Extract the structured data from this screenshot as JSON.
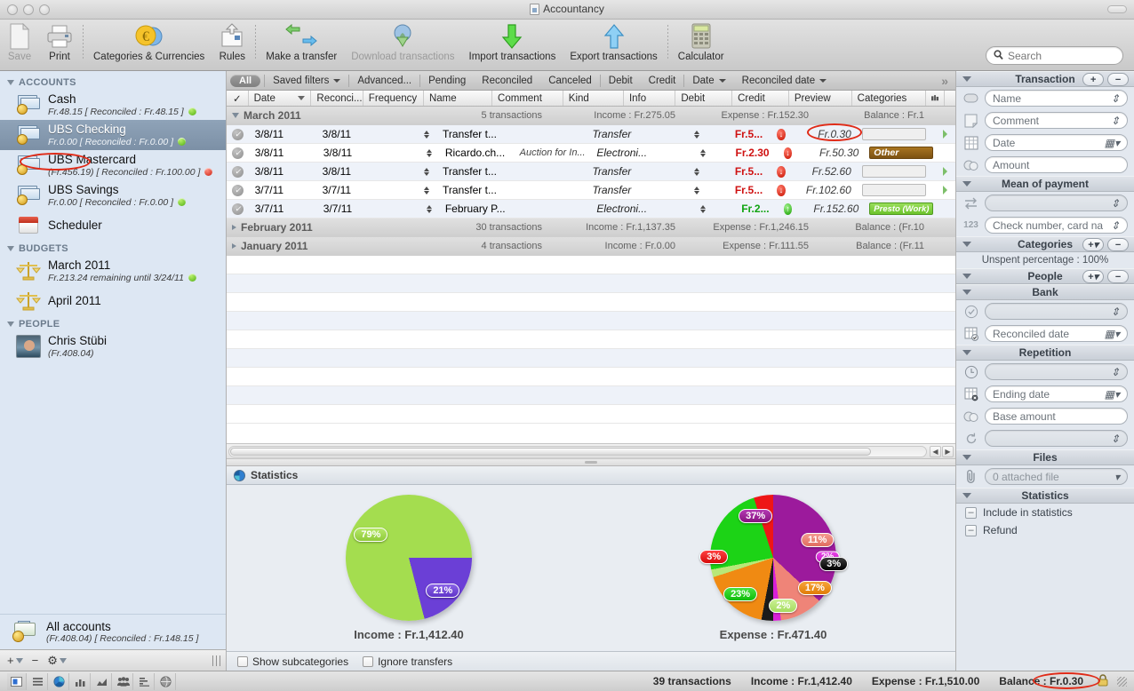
{
  "window": {
    "title": "Accountancy"
  },
  "toolbar": {
    "items": [
      {
        "label": "Save",
        "icon": "save-document-icon",
        "dim": true
      },
      {
        "label": "Print",
        "icon": "printer-icon",
        "dim": false
      },
      {
        "label": "Categories & Currencies",
        "icon": "euro-coin-icon",
        "dim": false
      },
      {
        "label": "Rules",
        "icon": "rules-envelope-icon",
        "dim": false
      },
      {
        "label": "Make a transfer",
        "icon": "transfer-arrows-icon",
        "dim": false
      },
      {
        "label": "Download transactions",
        "icon": "globe-download-icon",
        "dim": true
      },
      {
        "label": "Import transactions",
        "icon": "green-down-arrow-icon",
        "dim": false
      },
      {
        "label": "Export transactions",
        "icon": "blue-up-arrow-icon",
        "dim": false
      },
      {
        "label": "Calculator",
        "icon": "calculator-icon",
        "dim": false
      }
    ],
    "search_placeholder": "Search"
  },
  "sidebar": {
    "groups": [
      {
        "title": "ACCOUNTS",
        "items": [
          {
            "name": "Cash",
            "sub": "Fr.48.15 [ Reconciled : Fr.48.15 ]",
            "status": "green",
            "icon": "money-icon",
            "selected": false
          },
          {
            "name": "UBS Checking",
            "sub": "Fr.0.00 [ Reconciled : Fr.0.00 ]",
            "status": "green",
            "icon": "money-icon",
            "selected": true
          },
          {
            "name": "UBS Mastercard",
            "sub": "(Fr.456.19) [ Reconciled : Fr.100.00 ]",
            "status": "red",
            "icon": "money-icon",
            "selected": false
          },
          {
            "name": "UBS Savings",
            "sub": "Fr.0.00 [ Reconciled : Fr.0.00 ]",
            "status": "green",
            "icon": "money-icon",
            "selected": false
          },
          {
            "name": "Scheduler",
            "sub": "",
            "status": "",
            "icon": "calendar-icon",
            "selected": false
          }
        ]
      },
      {
        "title": "BUDGETS",
        "items": [
          {
            "name": "March 2011",
            "sub": "Fr.213.24 remaining until 3/24/11",
            "status": "green",
            "icon": "scale-icon",
            "selected": false
          },
          {
            "name": "April 2011",
            "sub": "",
            "status": "",
            "icon": "scale-icon",
            "selected": false
          }
        ]
      },
      {
        "title": "PEOPLE",
        "items": [
          {
            "name": "Chris Stübi",
            "sub": "(Fr.408.04)",
            "status": "",
            "icon": "avatar-icon",
            "selected": false
          }
        ]
      }
    ],
    "all_accounts": {
      "name": "All accounts",
      "sub": "(Fr.408.04) [ Reconciled : Fr.148.15 ]"
    },
    "footer": {
      "add": "+",
      "remove": "−",
      "gear": "⚙"
    }
  },
  "filterbar": {
    "all": "All",
    "items": [
      "Saved filters",
      "Advanced...",
      "Pending",
      "Reconciled",
      "Canceled",
      "Debit",
      "Credit",
      "Date",
      "Reconciled date"
    ],
    "overflow": "»"
  },
  "table": {
    "columns": [
      "✓",
      "Date",
      "Reconci...",
      "Frequency",
      "Name",
      "Comment",
      "Kind",
      "Info",
      "Debit",
      "Credit",
      "Preview",
      "Categories"
    ],
    "groups": [
      {
        "label": "March 2011",
        "expanded": true,
        "transactions": "5 transactions",
        "income": "Income : Fr.275.05",
        "expense": "Expense : Fr.152.30",
        "balance": "Balance : Fr.1",
        "rows": [
          {
            "date": "3/8/11",
            "reconciled": "3/8/11",
            "frequency": "",
            "name": "Transfer t...",
            "comment": "",
            "kind": "Transfer",
            "info": "",
            "debit": "Fr.5...",
            "debit_dir": "down",
            "credit": "",
            "preview": "Fr.0.30",
            "category": "",
            "category_style": "empty",
            "marker": true
          },
          {
            "date": "3/8/11",
            "reconciled": "3/8/11",
            "frequency": "",
            "name": "Ricardo.ch...",
            "comment": "Auction for In...",
            "kind": "Electroni...",
            "info": "",
            "debit": "Fr.2.30",
            "debit_dir": "down",
            "credit": "",
            "preview": "Fr.50.30",
            "category": "Other",
            "category_style": "other",
            "marker": false
          },
          {
            "date": "3/8/11",
            "reconciled": "3/8/11",
            "frequency": "",
            "name": "Transfer t...",
            "comment": "",
            "kind": "Transfer",
            "info": "",
            "debit": "Fr.5...",
            "debit_dir": "down",
            "credit": "",
            "preview": "Fr.52.60",
            "category": "",
            "category_style": "empty",
            "marker": true
          },
          {
            "date": "3/7/11",
            "reconciled": "3/7/11",
            "frequency": "",
            "name": "Transfer t...",
            "comment": "",
            "kind": "Transfer",
            "info": "",
            "debit": "Fr.5...",
            "debit_dir": "down",
            "credit": "",
            "preview": "Fr.102.60",
            "category": "",
            "category_style": "empty",
            "marker": true
          },
          {
            "date": "3/7/11",
            "reconciled": "3/7/11",
            "frequency": "",
            "name": "February P...",
            "comment": "",
            "kind": "Electroni...",
            "info": "",
            "debit": "Fr.2...",
            "debit_dir": "up",
            "credit": "",
            "preview": "Fr.152.60",
            "category": "Presto (Work)",
            "category_style": "presto",
            "marker": false
          }
        ]
      },
      {
        "label": "February 2011",
        "expanded": false,
        "transactions": "30 transactions",
        "income": "Income : Fr.1,137.35",
        "expense": "Expense : Fr.1,246.15",
        "balance": "Balance : (Fr.10",
        "rows": []
      },
      {
        "label": "January 2011",
        "expanded": false,
        "transactions": "4 transactions",
        "income": "Income : Fr.0.00",
        "expense": "Expense : Fr.111.55",
        "balance": "Balance : (Fr.11",
        "rows": []
      }
    ]
  },
  "statistics": {
    "title": "Statistics",
    "show_subcategories": "Show subcategories",
    "ignore_transfers": "Ignore transfers"
  },
  "chart_data": [
    {
      "type": "pie",
      "title": "Income : Fr.1,412.40",
      "labels": [
        "79%",
        "21%"
      ],
      "values": [
        79,
        21
      ],
      "colors": [
        "#a4dd4f",
        "#6b3fd6"
      ],
      "legend": "none"
    },
    {
      "type": "pie",
      "title": "Expense : Fr.471.40",
      "labels": [
        "37%",
        "11%",
        "2%",
        "3%",
        "17%",
        "2%",
        "23%",
        "3%"
      ],
      "values": [
        37,
        11,
        2,
        3,
        17,
        2,
        23,
        3
      ],
      "colors": [
        "#9c1a9c",
        "#ef8478",
        "#d81fd8",
        "#1b1b1b",
        "#f08a12",
        "#b8e878",
        "#1cd316",
        "#ee1616"
      ],
      "legend": "none"
    }
  ],
  "inspector": {
    "sections": [
      {
        "title": "Transaction",
        "has_add": true,
        "has_remove": true,
        "add": "+",
        "remove": "−",
        "fields": [
          {
            "icon": "name-pill-icon",
            "label": "Name",
            "control": "stepper",
            "gray": false
          },
          {
            "icon": "comment-note-icon",
            "label": "Comment",
            "control": "stepper",
            "gray": false
          },
          {
            "icon": "calendar-grid-icon",
            "label": "Date",
            "control": "calendar",
            "gray": false
          },
          {
            "icon": "coins-icon",
            "label": "Amount",
            "control": "none",
            "gray": false
          }
        ]
      },
      {
        "title": "Mean of payment",
        "has_add": false,
        "has_remove": false,
        "fields": [
          {
            "icon": "exchange-arrows-icon",
            "label": "",
            "control": "stepper",
            "gray": true
          },
          {
            "icon": "number-123-icon",
            "label": "Check number, card na",
            "control": "stepper",
            "gray": false
          }
        ]
      },
      {
        "title": "Categories",
        "has_add": true,
        "has_remove": true,
        "add": "+▾",
        "remove": "−",
        "note": "Unspent percentage : 100%",
        "fields": []
      },
      {
        "title": "People",
        "has_add": true,
        "has_remove": true,
        "add": "+▾",
        "remove": "−",
        "fields": []
      },
      {
        "title": "Bank",
        "has_add": false,
        "has_remove": false,
        "fields": [
          {
            "icon": "check-circle-icon",
            "label": "",
            "control": "stepper",
            "gray": true
          },
          {
            "icon": "calendar-check-icon",
            "label": "Reconciled date",
            "control": "calendar",
            "gray": false
          }
        ]
      },
      {
        "title": "Repetition",
        "has_add": false,
        "has_remove": false,
        "fields": [
          {
            "icon": "clock-icon",
            "label": "",
            "control": "stepper",
            "gray": true
          },
          {
            "icon": "calendar-x-icon",
            "label": "Ending date",
            "control": "calendar",
            "gray": false
          },
          {
            "icon": "coins-icon",
            "label": "Base amount",
            "control": "none",
            "gray": false
          },
          {
            "icon": "refresh-icon",
            "label": "",
            "control": "stepper",
            "gray": true
          }
        ]
      },
      {
        "title": "Files",
        "has_add": false,
        "has_remove": false,
        "fields": [
          {
            "icon": "paperclip-icon",
            "label": "0 attached file",
            "control": "popup",
            "gray": true
          }
        ]
      },
      {
        "title": "Statistics",
        "has_add": false,
        "has_remove": false,
        "checkboxes": [
          {
            "label": "Include in statistics",
            "state": "mixed"
          },
          {
            "label": "Refund",
            "state": "mixed"
          }
        ],
        "fields": []
      }
    ]
  },
  "statusbar": {
    "icons": [
      "panel-icon",
      "list-icon",
      "pie-icon",
      "bar-chart-icon",
      "area-chart-icon",
      "people-icon",
      "ranking-icon",
      "globe-icon"
    ],
    "transactions": "39 transactions",
    "income": "Income : Fr.1,412.40",
    "expense": "Expense : Fr.1,510.00",
    "balance": "Balance : Fr.0.30",
    "lock": "lock-icon"
  }
}
